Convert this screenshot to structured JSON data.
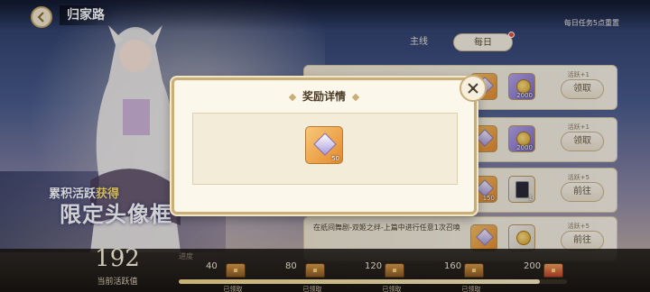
{
  "header": {
    "title": "归家路",
    "reset_note": "每日任务5点重置"
  },
  "tabs": [
    {
      "label": "主线",
      "active": false
    },
    {
      "label": "每日",
      "active": true
    }
  ],
  "banner": {
    "line1_prefix": "累积活跃",
    "line1_highlight": "获得",
    "line2": "限定头像框"
  },
  "tasks": [
    {
      "desc": "",
      "activity": "活跃+1",
      "button": "领取",
      "rewards": [
        {
          "type": "gem",
          "count": ""
        },
        {
          "type": "coin",
          "count": "2000"
        }
      ]
    },
    {
      "desc": "",
      "activity": "活跃+1",
      "button": "领取",
      "rewards": [
        {
          "type": "gem",
          "count": ""
        },
        {
          "type": "coin",
          "count": "2000"
        }
      ]
    },
    {
      "desc": "",
      "activity": "活跃+5",
      "button": "前往",
      "rewards": [
        {
          "type": "gem",
          "count": "150"
        },
        {
          "type": "card",
          "count": "1"
        }
      ]
    },
    {
      "desc": "在纸间舞剧-双姬之绊-上篇中进行任意1次召唤",
      "activity": "活跃+5",
      "button": "前往",
      "rewards": [
        {
          "type": "gem",
          "count": ""
        },
        {
          "type": "coin",
          "count": ""
        }
      ]
    }
  ],
  "modal": {
    "title": "奖励详情",
    "reward_count": "50",
    "reward_icon": "gem-icon"
  },
  "progress": {
    "current_value": "192",
    "current_label": "当前活跃值",
    "bar_label": "进度",
    "fraction": 0.93,
    "milestones": [
      {
        "value": "40",
        "status": "已领取"
      },
      {
        "value": "80",
        "status": "已领取"
      },
      {
        "value": "120",
        "status": "已领取"
      },
      {
        "value": "160",
        "status": "已领取"
      },
      {
        "value": "200",
        "status": ""
      }
    ]
  },
  "colors": {
    "accent_gold": "#c9ae77",
    "modal_bg": "#fbf7ea",
    "badge_red": "#e84a3a"
  }
}
